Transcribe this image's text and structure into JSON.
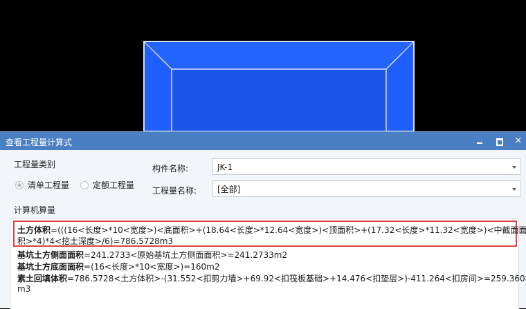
{
  "window": {
    "title": "查看工程量计算式",
    "controls": {
      "minimize": "minimize-icon",
      "maximize": "maximize-icon",
      "close": "×"
    }
  },
  "quantity_type": {
    "label": "工程量类别",
    "options": [
      {
        "label": "清单工程量",
        "checked": true
      },
      {
        "label": "定额工程量",
        "checked": false
      }
    ]
  },
  "fields": {
    "component_name_label": "构件名称:",
    "component_name_value": "JK-1",
    "quantity_name_label": "工程量名称:",
    "quantity_name_value": "[全部]"
  },
  "calc": {
    "section_label": "计算机算量",
    "lines": [
      {
        "name": "土方体积",
        "text": "=(((16<长度>*10<宽度>)<底面积>+(18.64<长度>*12.64<宽度>)<顶面积>+(17.32<长度>*11.32<宽度>)<中截面面"
      },
      {
        "name": "",
        "text": "积>*4)*4<挖土深度>/6)=786.5728m3"
      },
      {
        "name": "基坑土方侧面面积",
        "text": "=241.2733<原始基坑土方侧面面积>=241.2733m2"
      },
      {
        "name": "基坑土方底面面积",
        "text": "=(16<长度>*10<宽度>)=160m2"
      },
      {
        "name": "素土回填体积",
        "text": "=786.5728<土方体积>-(31.552<扣剪力墙>+69.92<扣筏板基础>+14.476<扣垫层>)-411.264<扣房间>=259.3608"
      },
      {
        "name": "",
        "text": "m3"
      }
    ]
  },
  "colors": {
    "viewport_bg": "#000000",
    "pit_fill": "#1e5bf0",
    "pit_outer": "#2a66ff",
    "pit_edge": "#cfd8f5",
    "titlebar": "#4a7fc4",
    "highlight_border": "#d9463f"
  }
}
